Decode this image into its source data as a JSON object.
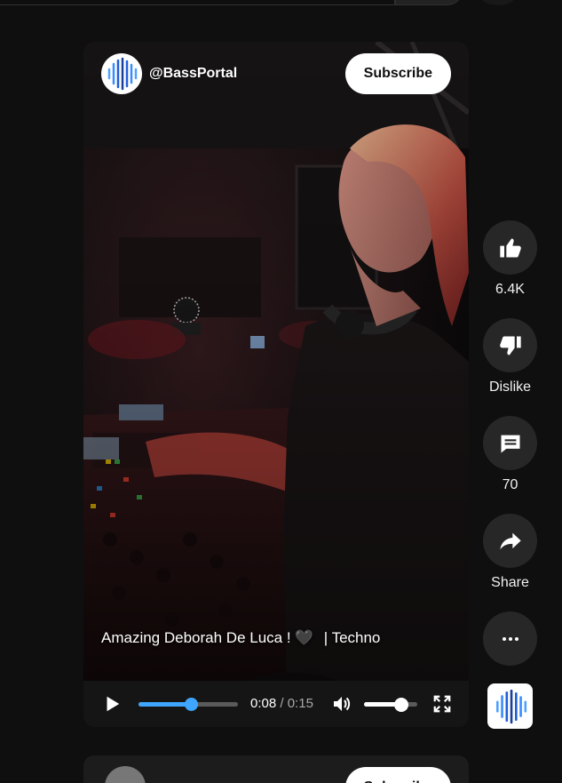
{
  "short": {
    "channel_handle": "@BassPortal",
    "subscribe_label": "Subscribe",
    "title": "Amazing Deborah De Luca !",
    "title_suffix": "| Techno",
    "heart_emoji": "🖤",
    "current_time": "0:08",
    "time_separator": "/",
    "duration": "0:15",
    "progress": 0.53,
    "volume": 0.7
  },
  "actions": {
    "like_label": "6.4K",
    "dislike_label": "Dislike",
    "comments_label": "70",
    "share_label": "Share"
  },
  "icons": {
    "play": "play-icon",
    "volume": "volume-icon",
    "fullscreen": "fullscreen-icon",
    "like": "thumbs-up-icon",
    "dislike": "thumbs-down-icon",
    "comment": "comment-icon",
    "share": "share-icon",
    "more": "more-icon"
  },
  "next_short": {
    "subscribe_label": "Subscribe"
  },
  "colors": {
    "background": "#0f0f0f",
    "progress_accent": "#3ea6ff",
    "button_bg": "#272727",
    "brand_blue": "#1e5fd8"
  }
}
